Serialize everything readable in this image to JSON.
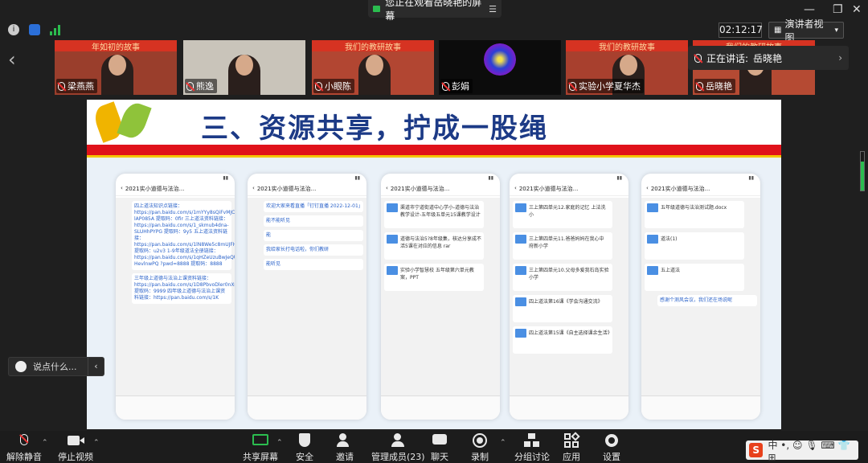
{
  "top_banner": {
    "text": "您正在观看岳晓艳的屏幕"
  },
  "window": {
    "clock": "02:12:17",
    "view_mode": "演讲者视图"
  },
  "participants": [
    {
      "name": "梁燕燕",
      "banner": "年如初的故事"
    },
    {
      "name": "熊逸",
      "banner": ""
    },
    {
      "name": "小眼陈",
      "banner": "我们的教研故事"
    },
    {
      "name": "彭娟",
      "banner": ""
    },
    {
      "name": "实验小学夏华杰",
      "banner": "我们的教研故事"
    },
    {
      "name": "岳晓艳",
      "banner": "我们的教研故事"
    }
  ],
  "speaker": {
    "label": "正在讲话:",
    "name": "岳晓艳"
  },
  "slide": {
    "title": "三、资源共享，拧成一股绳",
    "phones": [
      {
        "header": "2021实小道德与法治...",
        "messages": [
          "四上道法知识点链接：https://pan.baidu.com/s/1mYYy8sQiFvMJCS5-lAP085A 提取码：0fir 三上道法资料链接：https://pan.baidu.com/s/1_skmub4dna-SLUHhPYPG 提取码：9y5 五上道法资料链接：https://pan.baidu.com/s/1lN8We5c8mUJFHRt5gmKbdA 提取码：u2v3 1-9年级道法全册链接：https://pan.baidu.com/s/1qHZeUzuBwJeQU-HevlnwPQ ?pwd=8888 提取码：8888",
          "三年级上道德与法治上课资料链接：https://pan.baidu.com/s/1D8PbvoDler0nXsGDeHoovA 提取码：9999 四年级上道德与法治上课资料链接：https://pan.baidu.com/s/1K"
        ]
      },
      {
        "header": "2021实小道德与法治...",
        "messages": [
          "欢迎大家来看直播「钉钉直播 2022-12-01」",
          "能不能听见",
          "能",
          "我给家长打电话啦，你们教研",
          "能听见"
        ]
      },
      {
        "header": "2021实小道德与法治...",
        "files": [
          "渠道市宁道街道中心学小-道德与法治教学设计-五年级五单元15课教学设计",
          "道德与法治5?8年级集，核达分享成不活5课在对应的信息 rar",
          "实验小学智慧校 五年级第六单元教案，PPT"
        ]
      },
      {
        "header": "2021实小道德与法治...",
        "files": [
          "三上第四单元12.家庭的记忆 上法洗小",
          "三上第四单元11.爸爸妈妈在我心中 府新小学",
          "三上第四单元10.父母多爱我石岛实验小学",
          "四上道法第16课《学会沟通交流》",
          "四上道法第15课《自主选择课余生活》"
        ]
      },
      {
        "header": "2021实小道德与法治...",
        "files": [
          "五年级道德与法治测试题.docx",
          "道法(1)",
          "五上道法"
        ],
        "messages": [
          "感谢个测风会议，我们还在场说呢"
        ]
      }
    ]
  },
  "chat_prompt": {
    "placeholder": "说点什么..."
  },
  "toolbar": {
    "unmute": "解除静音",
    "stop_video": "停止视频",
    "share_screen": "共享屏幕",
    "security": "安全",
    "invite": "邀请",
    "manage_members": "管理成员(23)",
    "chat": "聊天",
    "record": "录制",
    "breakout": "分组讨论",
    "apps": "应用",
    "settings": "设置"
  },
  "ime": {
    "logo": "S",
    "text": "中 •, ☺ 🎙 ⌨ 👕 ⊞"
  },
  "colors": {
    "accent_green": "#2bbd4f",
    "title_blue": "#1c3a86",
    "slide_red": "#e0121a"
  }
}
